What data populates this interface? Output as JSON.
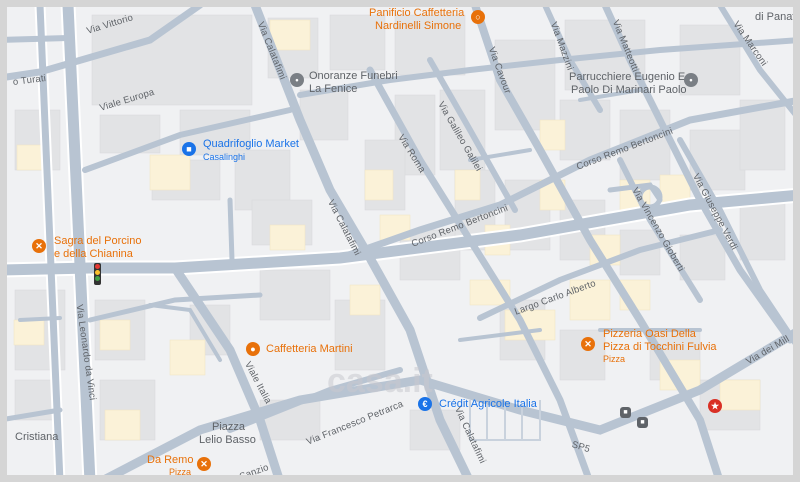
{
  "map": {
    "colors": {
      "background": "#f0f1f3",
      "road": "#b8c4d2",
      "road_major": "#aab8c8",
      "building": "#e2e3e5",
      "highlight": "#fbf2d8",
      "poi_food": "#e8710a",
      "poi_shop": "#1a73e8",
      "poi_service": "#7a7f85"
    },
    "places": [
      {
        "id": "panificio",
        "name": "Panificio Caffetteria",
        "name2": "Nardinelli Simone",
        "category": "food",
        "icon": "bread-icon"
      },
      {
        "id": "onoranze",
        "name": "Onoranze Funebri",
        "name2": "La Fenice",
        "category": "service",
        "icon": "pin-icon"
      },
      {
        "id": "parrucchiere",
        "name": "Parrucchiere Eugenio E",
        "name2": "Paolo Di Marinari Paolo",
        "category": "service",
        "icon": "pin-icon"
      },
      {
        "id": "quadrifoglio",
        "name": "Quadrifoglio Market",
        "sub": "Casalinghi",
        "category": "shop",
        "icon": "shopping-bag-icon"
      },
      {
        "id": "sagra",
        "name": "Sagra del Porcino",
        "name2": "e della Chianina",
        "category": "food",
        "icon": "restaurant-icon"
      },
      {
        "id": "cafmartini",
        "name": "Caffetteria Martini",
        "category": "food",
        "icon": "coffee-icon"
      },
      {
        "id": "pizzeria",
        "name": "Pizzeria Oasi Della",
        "name2": "Pizza di Tocchini Fulvia",
        "sub": "Pizza",
        "category": "food",
        "icon": "restaurant-icon"
      },
      {
        "id": "credit",
        "name": "Crédit Agricole Italia",
        "category": "shop",
        "icon": "bank-icon"
      },
      {
        "id": "daremo",
        "name": "Da Remo",
        "sub": "Pizza",
        "category": "food",
        "icon": "restaurant-icon"
      }
    ],
    "labels": {
      "piazza1": "Piazza",
      "piazza2": "Lelio Basso",
      "cristiana": "Cristiana",
      "di_panatt": "di Panatt"
    },
    "roads": {
      "vittorio": "Via Vittorio",
      "turati": "o Turati",
      "europa": "Viale Europa",
      "calatafimi_top": "Via Calatafimi",
      "calatafimi_mid": "Via Calatafimi",
      "calatafimi_bot": "Via Calatafimi",
      "roma": "Via Roma",
      "galileo": "Via Galileo Galilei",
      "cavour": "Via Cavour",
      "mazzini": "Via Mazzini",
      "matteotti": "Via Matteotti",
      "marconi": "Via Marconi",
      "bertoncini1": "Corso Remo Bertoncini",
      "bertoncini2": "Corso Remo Bertoncini",
      "gioberti": "Via Vincenzo Gioberti",
      "verdi": "Via Giuseppe Verdi",
      "alberto": "Largo Carlo Alberto",
      "leonardo": "Via Leonardo da Vinci",
      "italia": "Viale Italia",
      "petrarca": "Via Francesco Petrarca",
      "sanzio": "Sanzio",
      "sp5": "SP5",
      "mille": "Via dei Mill"
    },
    "google_logo": "Google",
    "watermark": "casa.it",
    "icons": {
      "transit": "bus-stop-icon",
      "traffic": "traffic-light-icon",
      "attraction": "landmark-icon"
    }
  }
}
